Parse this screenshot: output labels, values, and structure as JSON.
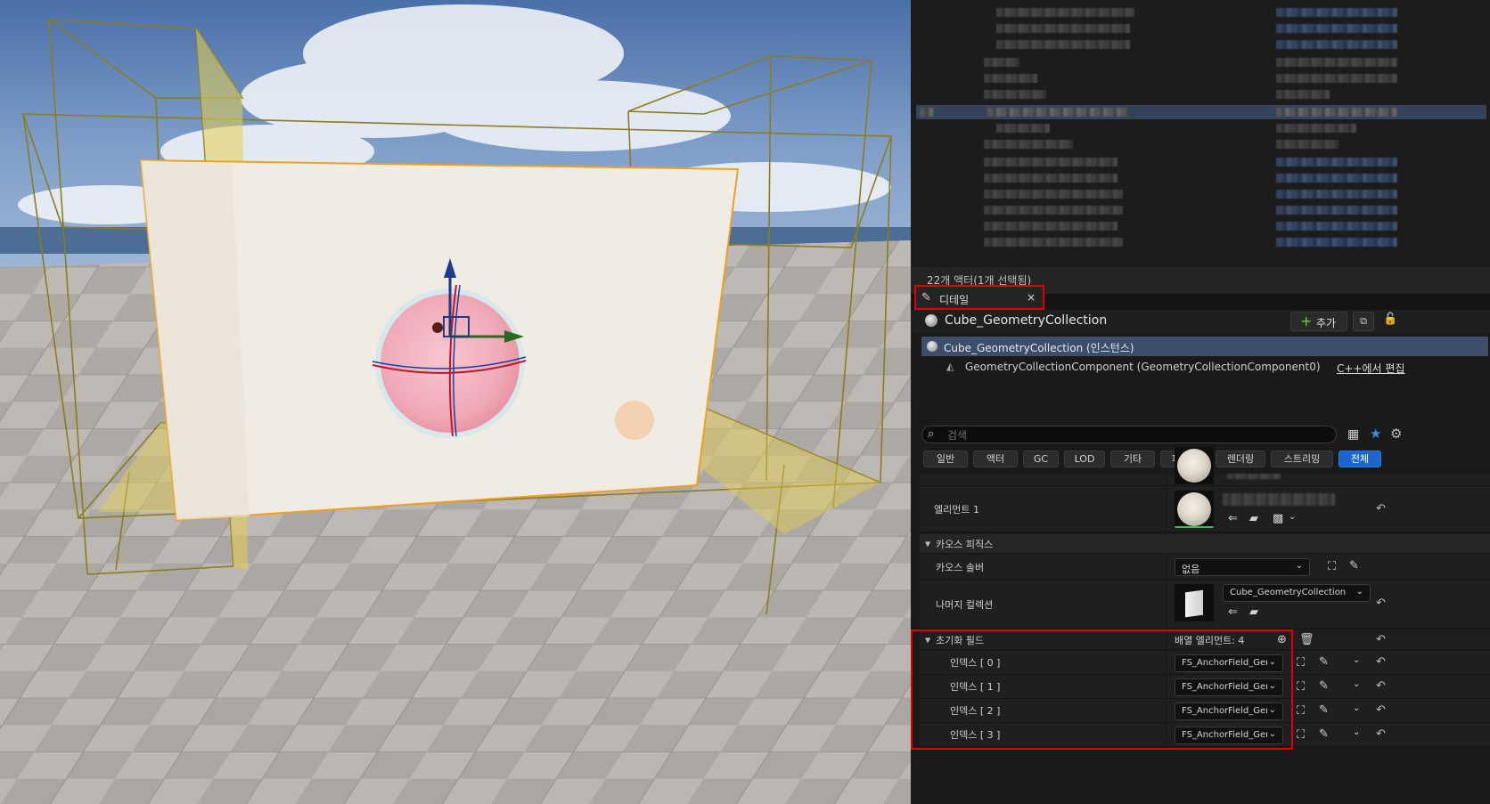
{
  "outliner": {
    "actor_count": "22개 액터(1개 선택됨)"
  },
  "details_tab": {
    "label": "디테일",
    "close": "×",
    "icon": "pencil-icon"
  },
  "actor": {
    "name": "Cube_GeometryCollection",
    "add_label": "추가",
    "add_icon": "plus-icon"
  },
  "components": {
    "root": "Cube_GeometryCollection (인스턴스)",
    "child": "GeometryCollectionComponent (GeometryCollectionComponent0)",
    "edit_cpp": "C++에서 편집"
  },
  "search": {
    "placeholder": "검색"
  },
  "filters": [
    "일반",
    "액터",
    "GC",
    "LOD",
    "기타",
    "피직스",
    "렌더링",
    "스트리밍",
    "전체"
  ],
  "active_filter": "전체",
  "properties": {
    "element1_label": "엘리먼트 1",
    "chaos_section": "카오스 피직스",
    "chaos_solver_label": "카오스 솔버",
    "chaos_solver_value": "없음",
    "rest_collection_label": "나머지 컬렉션",
    "rest_collection_value": "Cube_GeometryCollection",
    "init_fields_label": "초기화 필드",
    "array_elements": "배열 엘리먼트: 4",
    "indices": [
      {
        "label": "인덱스 [ 0 ]",
        "value": "FS_AnchorField_Gen"
      },
      {
        "label": "인덱스 [ 1 ]",
        "value": "FS_AnchorField_Gen"
      },
      {
        "label": "인덱스 [ 2 ]",
        "value": "FS_AnchorField_Gen"
      },
      {
        "label": "인덱스 [ 3 ]",
        "value": "FS_AnchorField_Gen"
      }
    ]
  },
  "colors": {
    "highlight": "#e00000",
    "active_filter": "#1a66cc",
    "selection": "#3d4e6c"
  }
}
